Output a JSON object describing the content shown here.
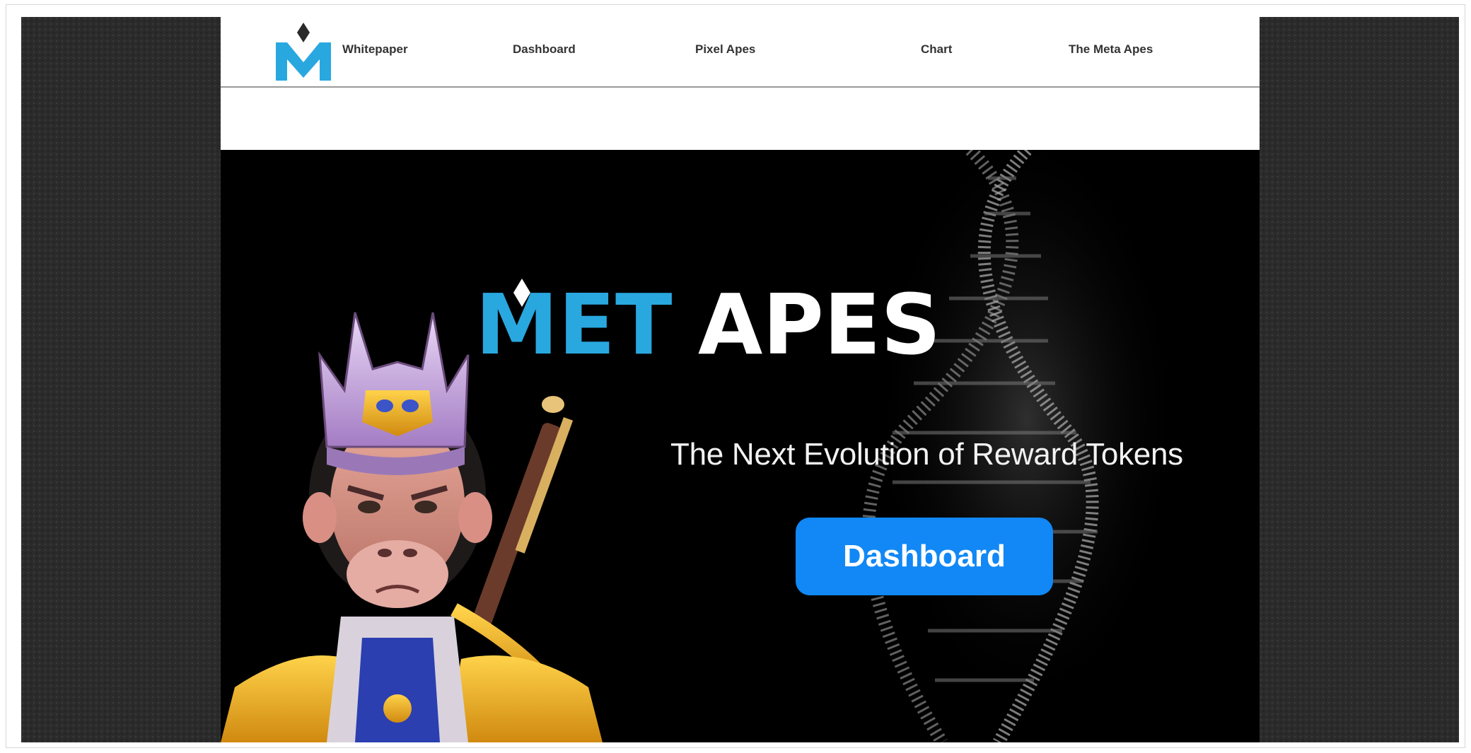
{
  "nav": {
    "items": [
      {
        "label": "Whitepaper"
      },
      {
        "label": "Dashboard"
      },
      {
        "label": "Pixel Apes"
      },
      {
        "label": "Chart"
      },
      {
        "label": "The Meta Apes"
      }
    ]
  },
  "hero": {
    "brand_meta": "MET",
    "brand_apes": "APES",
    "tagline": "The Next Evolution of Reward Tokens",
    "cta_label": "Dashboard"
  },
  "colors": {
    "brand_blue": "#29a8e0",
    "cta_blue": "#1188f5",
    "hero_bg": "#000000",
    "side_bg": "#2b2b2b"
  },
  "icons": {
    "logo": "metapes-m-diamond-logo"
  }
}
